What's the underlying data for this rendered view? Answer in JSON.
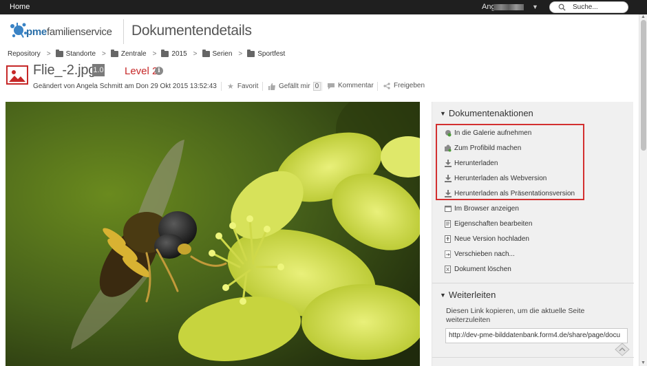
{
  "topbar": {
    "home": "Home",
    "user": "Ange",
    "search_placeholder": "Suche..."
  },
  "header": {
    "logo_brand": "pme",
    "logo_rest": "familienservice",
    "page_title": "Dokumentendetails"
  },
  "breadcrumb": [
    "Repository",
    "Standorte",
    "Zentrale",
    "2015",
    "Serien",
    "Sportfest"
  ],
  "document": {
    "filename": "Flie_-2.jpg",
    "version": "1.0",
    "level": "Level 2",
    "modified": "Geändert von Angela Schmitt am Don 29 Okt 2015 13:52:43",
    "favorite": "Favorit",
    "like": "Gefällt mir",
    "like_count": "0",
    "comment": "Kommentar",
    "share": "Freigeben"
  },
  "panel": {
    "actions_title": "Dokumentenaktionen",
    "actions": [
      {
        "label": "In die Galerie aufnehmen",
        "icon": "gallery-icon"
      },
      {
        "label": "Zum Profibild machen",
        "icon": "profile-image-icon"
      },
      {
        "label": "Herunterladen",
        "icon": "download-icon"
      },
      {
        "label": "Herunterladen als Webversion",
        "icon": "download-icon"
      },
      {
        "label": "Herunterladen als Präsentationsversion",
        "icon": "download-icon"
      },
      {
        "label": "Im Browser anzeigen",
        "icon": "browser-icon"
      },
      {
        "label": "Eigenschaften bearbeiten",
        "icon": "edit-properties-icon"
      },
      {
        "label": "Neue Version hochladen",
        "icon": "upload-icon"
      },
      {
        "label": "Verschieben nach...",
        "icon": "move-icon"
      },
      {
        "label": "Dokument löschen",
        "icon": "delete-icon"
      }
    ],
    "forward_title": "Weiterleiten",
    "forward_desc": "Diesen Link kopieren, um die aktuelle Seite weiterzuleiten",
    "forward_link": "http://dev-pme-bilddatenbank.form4.de/share/page/docu"
  },
  "colors": {
    "accent_red": "#c62828",
    "highlight_red": "#d32f2f",
    "topbar": "#1f1f1f",
    "brand_blue": "#2a6fa8"
  }
}
